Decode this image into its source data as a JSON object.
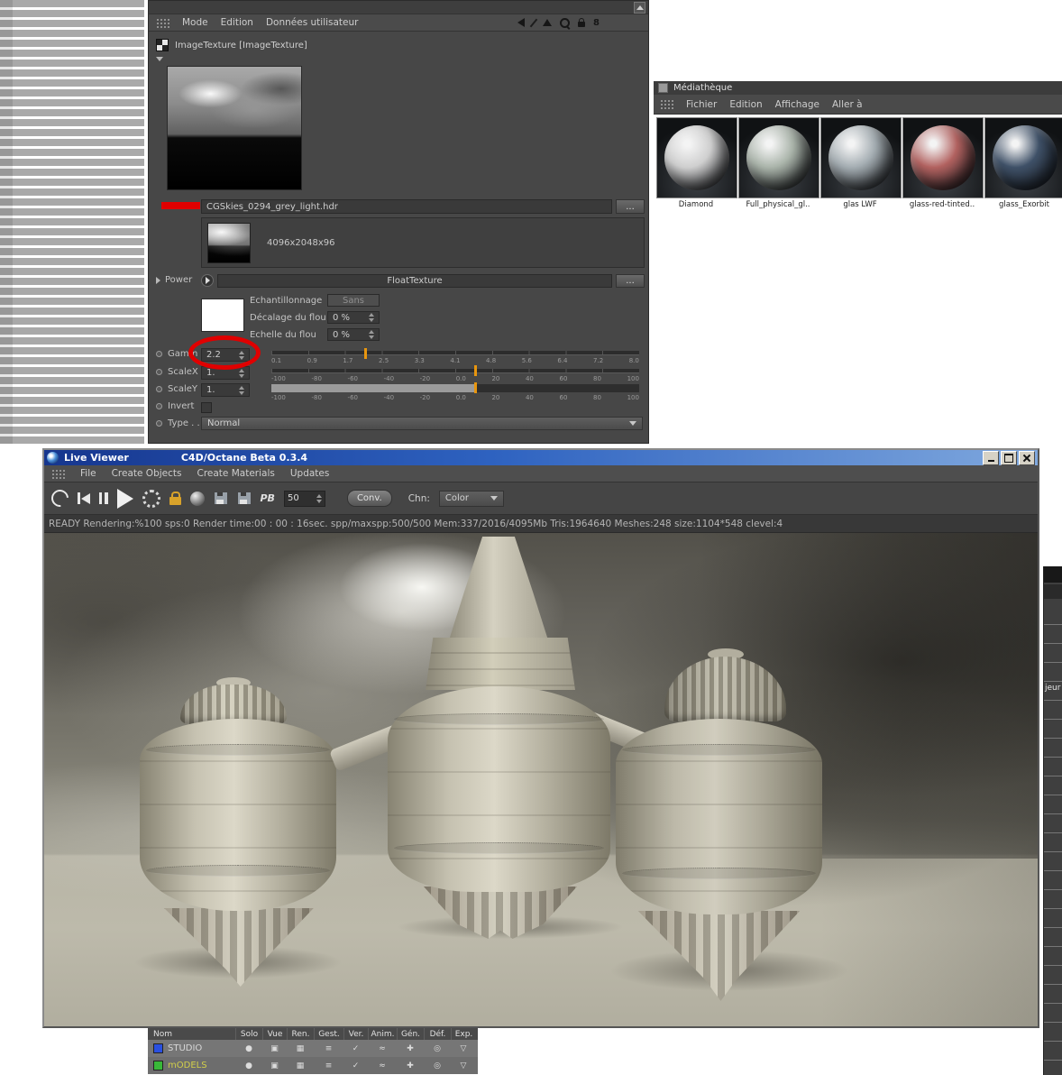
{
  "annotations": {
    "color": "#e00000"
  },
  "attribute_manager": {
    "menu_items": [
      "Mode",
      "Edition",
      "Données utilisateur"
    ],
    "nav_badge": "8",
    "texture_title": "ImageTexture [ImageTexture]",
    "filename": "CGSkies_0294_grey_light.hdr",
    "browse_label": "...",
    "resolution": "4096x2048x96",
    "power_label": "Power",
    "float_texture_label": "FloatTexture",
    "sampling_label": "Echantillonnage",
    "sampling_value": "Sans",
    "blur_offset_label": "Décalage du flou",
    "blur_offset_value": "0 %",
    "blur_scale_label": "Echelle du flou",
    "blur_scale_value": "0 %",
    "gamma_label": "Gamm",
    "gamma_value": "2.2",
    "scalex_label": "ScaleX",
    "scalex_value": "1.",
    "scaley_label": "ScaleY",
    "scaley_value": "1.",
    "invert_label": "Invert",
    "type_label": "Type . .",
    "type_value": "Normal",
    "gamma_ticks": [
      "0.1",
      "0.9",
      "1.7",
      "2.5",
      "3.3",
      "4.1",
      "4.8",
      "5.6",
      "6.4",
      "7.2",
      "8.0"
    ],
    "scale_ticks": [
      "-100",
      "-80",
      "-60",
      "-40",
      "-20",
      "0.0",
      "20",
      "40",
      "60",
      "80",
      "100"
    ]
  },
  "mediatheque": {
    "title": "Médiathèque",
    "menu_items": [
      "Fichier",
      "Edition",
      "Affichage",
      "Aller à"
    ],
    "materials": [
      {
        "name": "Diamond",
        "color": "#cfcfcf"
      },
      {
        "name": "Full_physical_gl..",
        "color": "#aab4aa"
      },
      {
        "name": "glas LWF",
        "color": "#a4adb2"
      },
      {
        "name": "glass-red-tinted..",
        "color": "#b26260"
      },
      {
        "name": "glass_Exorbit",
        "color": "#3f5168"
      }
    ]
  },
  "live_viewer": {
    "title": "Live Viewer",
    "version": "C4D/Octane Beta 0.3.4",
    "menu_items": [
      "File",
      "Create Objects",
      "Create Materials",
      "Updates"
    ],
    "toolbar": {
      "pb_label": "PB",
      "samples_value": "50",
      "conv_label": "Conv.",
      "chn_label": "Chn:",
      "channel_value": "Color"
    },
    "status": "READY Rendering:%100 sps:0 Render time:00 : 00 : 16sec. spp/maxspp:500/500 Mem:337/2016/4095Mb Tris:1964640 Meshes:248 size:1104*548 clevel:4"
  },
  "object_manager": {
    "columns": [
      "Nom",
      "Solo",
      "Vue",
      "Ren.",
      "Gest.",
      "Ver.",
      "Anim.",
      "Gén.",
      "Déf.",
      "Exp."
    ],
    "icon_glyphs": {
      "solo": "●",
      "vue": "▣",
      "ren": "▦",
      "gest": "≡",
      "ver": "✓",
      "anim": "≈",
      "gen": "✚",
      "def": "◎",
      "exp": "▽"
    },
    "rows": [
      {
        "name": "STUDIO",
        "chip_color": "#2a50e0",
        "name_color": "#d8d8d8"
      },
      {
        "name": "mODELS",
        "chip_color": "#38b838",
        "name_color": "#d2cf4a"
      }
    ]
  },
  "right_strip": {
    "partial_label": "jeur"
  }
}
